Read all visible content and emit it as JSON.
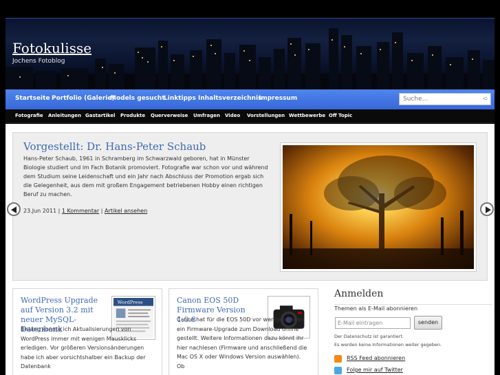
{
  "site": {
    "title": "Fotokulisse",
    "description": "Jochens Fotoblog"
  },
  "nav": {
    "items": [
      "Startseite",
      "Portfolio (Galerie)",
      "Models gesucht",
      "Linktipps",
      "Inhaltsverzeichnis",
      "Impressum"
    ],
    "search_placeholder": "Suche..."
  },
  "subnav": {
    "items": [
      "Fotografie",
      "Anleitungen",
      "Gastartikel",
      "Produkte",
      "Querverweise",
      "Umfragen",
      "Video",
      "Vorstellungen",
      "Wettbewerbe",
      "Off Topic"
    ]
  },
  "featured": {
    "title": "Vorgestellt: Dr. Hans-Peter Schaub",
    "text": "Hans-Peter Schaub, 1961 in Schramberg im Schwarzwald geboren, hat in Münster Biologie studiert und im Fach Botanik promoviert. Fotografie war schon vor und während dem Studium seine Leidenschaft und ein Jahr nach Abschluss der Promotion ergab sich die Gelegenheit, aus dem mit großem Engagement betriebenen Hobby einen richtigen Beruf zu machen.",
    "date": "23.Jun 2011",
    "comments": "1 Kommentar",
    "read_more": "Artikel ansehen"
  },
  "posts": [
    {
      "title": "WordPress Upgrade auf Version 3.2 mit neuer MySQL-Datenbank",
      "text": "Bislang konnte ich Aktualisierungen von WordPress immer mit wenigen Mausklicks erledigen. Vor größeren Versionsänderungen habe ich aber vorsichtshalber ein Backup der Datenbank"
    },
    {
      "title": "Canon EOS 50D Firmware Version 1.0.8",
      "text": "Canon hat für die EOS 50D vor wenigen Tagen ein Firmware-Upgrade zum Download online gestellt. Weitere Informationen dazu könnt ihr hier nachlesen (Firmware und anschließend die Mac OS X oder Windows Version auswählen). Ob"
    }
  ],
  "sidebar": {
    "title": "Anmelden",
    "subtitle": "Themen als E-Mail abonnieren",
    "email_placeholder": "E-Mail eintragen",
    "send_label": "senden",
    "note1": "Der Datenschutz ist garantiert.",
    "note2": "Es werden keine Informationen weiter gegeben.",
    "rss_label": "RSS Feed abonnieren",
    "twitter_label": "Folge mir auf Twitter"
  },
  "colors": {
    "accent": "#3e69b4",
    "nav": "#4a7de8",
    "rss": "#f28b16",
    "twitter": "#4aa7e6"
  },
  "icons": [
    "search-icon",
    "arrow-left-icon",
    "arrow-right-icon",
    "rss-icon",
    "twitter-icon"
  ]
}
